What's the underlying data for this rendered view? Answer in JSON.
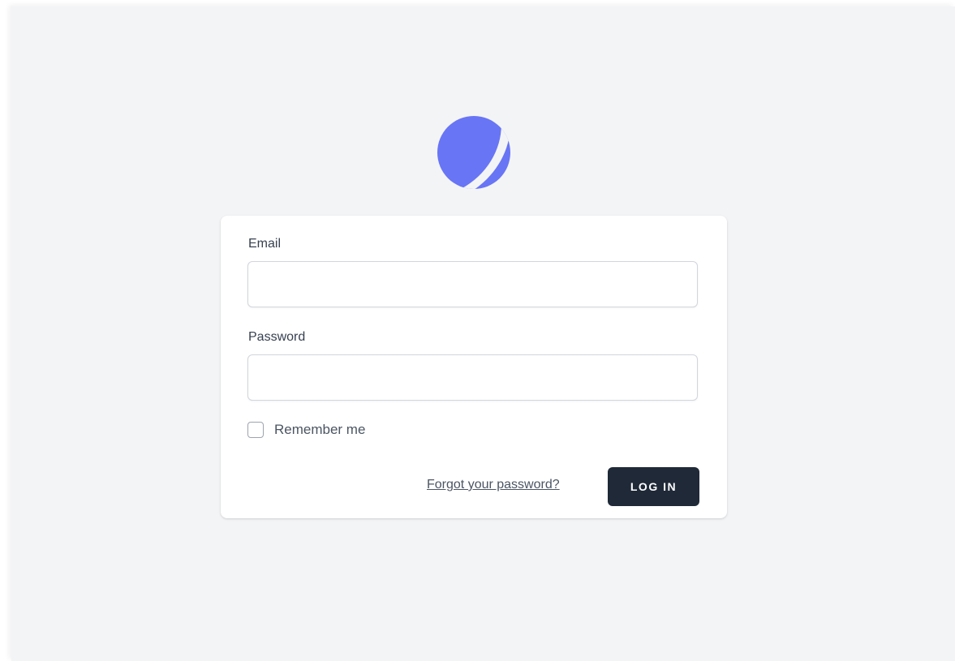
{
  "app": {
    "logo_icon": "globe-logo-icon",
    "accent_color": "#6875f5"
  },
  "form": {
    "email_label": "Email",
    "email_value": "",
    "password_label": "Password",
    "password_value": "",
    "remember_label": "Remember me",
    "remember_checked": false,
    "forgot_link": "Forgot your password?",
    "login_button": "LOG IN"
  },
  "colors": {
    "page_background": "#f3f4f6",
    "card_background": "#ffffff",
    "button_background": "#1f2937"
  }
}
